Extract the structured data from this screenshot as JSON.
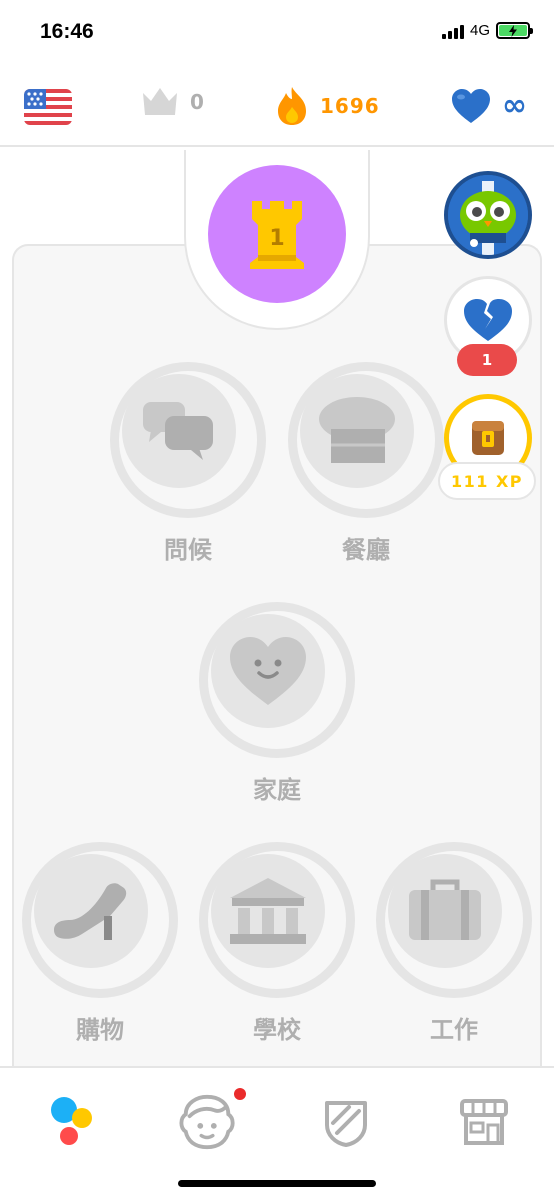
{
  "status_bar": {
    "time": "16:46",
    "network": "4G"
  },
  "top_bar": {
    "language_flag": "us-flag-icon",
    "crowns": "0",
    "streak": "1696",
    "hearts": "∞"
  },
  "castle": {
    "level": "1",
    "color": "#ce82ff"
  },
  "skills": [
    {
      "label": "問候",
      "icon": "chat-bubbles-icon"
    },
    {
      "label": "餐廳",
      "icon": "chef-hat-icon"
    },
    {
      "label": "家庭",
      "icon": "smiling-heart-icon"
    },
    {
      "label": "購物",
      "icon": "high-heel-icon"
    },
    {
      "label": "學校",
      "icon": "building-icon"
    },
    {
      "label": "工作",
      "icon": "briefcase-icon"
    }
  ],
  "side_widgets": {
    "broken_hearts_count": "1",
    "xp_label": "111 XP"
  },
  "bottom_nav": [
    {
      "name": "learn",
      "icon": "learn-dots-icon"
    },
    {
      "name": "stories",
      "icon": "character-face-icon"
    },
    {
      "name": "leagues",
      "icon": "shield-icon"
    },
    {
      "name": "shop",
      "icon": "shop-icon"
    }
  ],
  "colors": {
    "streak": "#ff9600",
    "hearts": "#2b70c9",
    "locked": "#e5e5e5",
    "xp": "#ffc800",
    "badge_red": "#ea4a4a"
  }
}
